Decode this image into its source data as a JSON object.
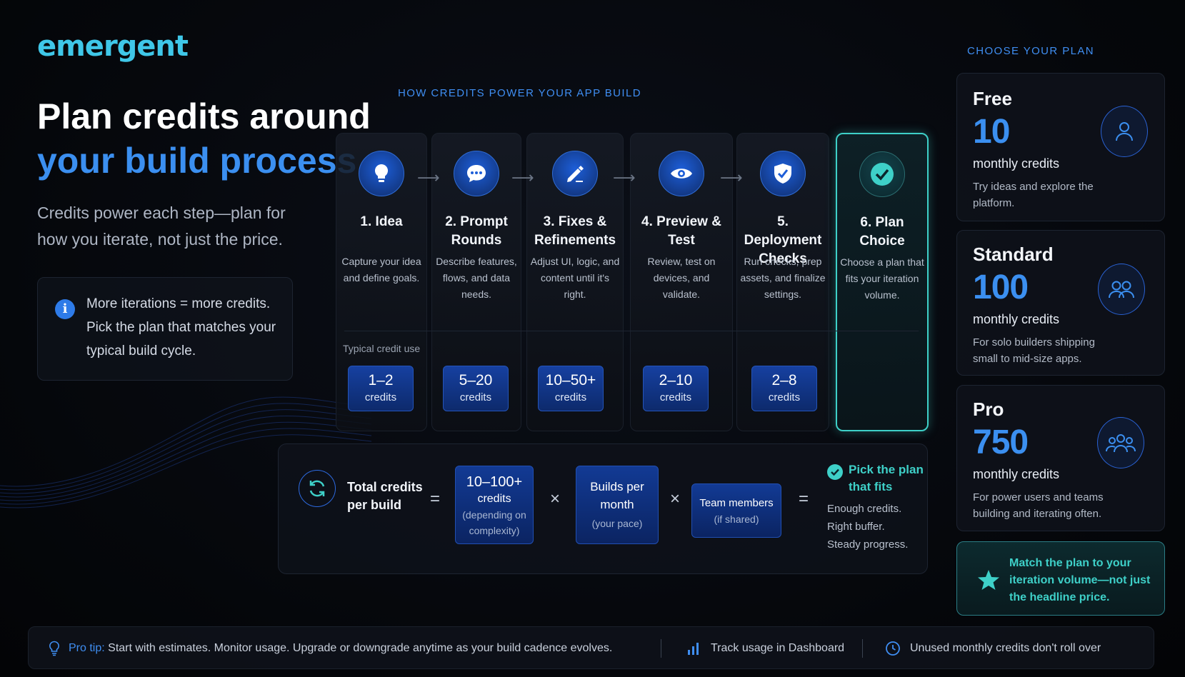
{
  "brand": {
    "logo": "emergent"
  },
  "hero": {
    "title_line1": "Plan credits around",
    "title_line2": "your build process",
    "subtitle": "Credits power each step—plan for how you iterate, not just the price.",
    "info_text": "More iterations = more credits. Pick the plan that matches your typical build cycle."
  },
  "steps_section": {
    "label": "HOW CREDITS POWER YOUR APP BUILD",
    "typical_label": "Typical credit use",
    "steps": [
      {
        "icon": "lightbulb-icon",
        "title": "1. Idea",
        "desc": "Capture your idea and define goals.",
        "credits": "1–2",
        "unit": "credits"
      },
      {
        "icon": "chat-bubble-icon",
        "title": "2. Prompt Rounds",
        "desc": "Describe features, flows, and data needs.",
        "credits": "5–20",
        "unit": "credits"
      },
      {
        "icon": "pencil-icon",
        "title": "3. Fixes & Refinements",
        "desc": "Adjust UI, logic, and content until it's right.",
        "credits": "10–50+",
        "unit": "credits"
      },
      {
        "icon": "eye-icon",
        "title": "4. Preview & Test",
        "desc": "Review, test on devices, and validate.",
        "credits": "2–10",
        "unit": "credits"
      },
      {
        "icon": "shield-check-icon",
        "title": "5. Deployment Checks",
        "desc": "Run checks, prep assets, and finalize settings.",
        "credits": "2–8",
        "unit": "credits"
      },
      {
        "icon": "check-circle-icon",
        "title": "6. Plan Choice",
        "desc": "Choose a plan that fits your iteration volume."
      }
    ]
  },
  "formula": {
    "total_label": "Total credits per build",
    "equals": "=",
    "times": "×",
    "term1_value": "10–100+",
    "term1_unit": "credits",
    "term1_note": "(depending on complexity)",
    "term2_label": "Builds per month",
    "term2_note": "(your pace)",
    "term3_label": "Team members",
    "term3_note": "(if shared)",
    "result_title": "Pick the plan that fits",
    "result_desc": "Enough credits. Right buffer. Steady progress."
  },
  "plans": {
    "label": "CHOOSE YOUR PLAN",
    "items": [
      {
        "name": "Free",
        "credits": "10",
        "unit": "monthly credits",
        "desc": "Try ideas and explore the platform.",
        "icon": "user-icon"
      },
      {
        "name": "Standard",
        "credits": "100",
        "unit": "monthly credits",
        "desc": "For solo builders shipping small to mid-size apps.",
        "icon": "two-users-icon"
      },
      {
        "name": "Pro",
        "credits": "750",
        "unit": "monthly credits",
        "desc": "For power users and teams building and iterating often.",
        "icon": "team-icon"
      }
    ],
    "match_text": "Match the plan to your iteration volume—not just the headline price."
  },
  "footer": {
    "protip_label": "Pro tip:",
    "protip_text": "Start with estimates.  Monitor usage. Upgrade or  downgrade anytime as your build cadence evolves.",
    "track_text": "Track usage in Dashboard",
    "rollover_text": "Unused monthly credits don't roll over"
  },
  "colors": {
    "accent_blue": "#3b8ff0",
    "accent_teal": "#3ed0c8",
    "logo": "#3fc7e8"
  }
}
